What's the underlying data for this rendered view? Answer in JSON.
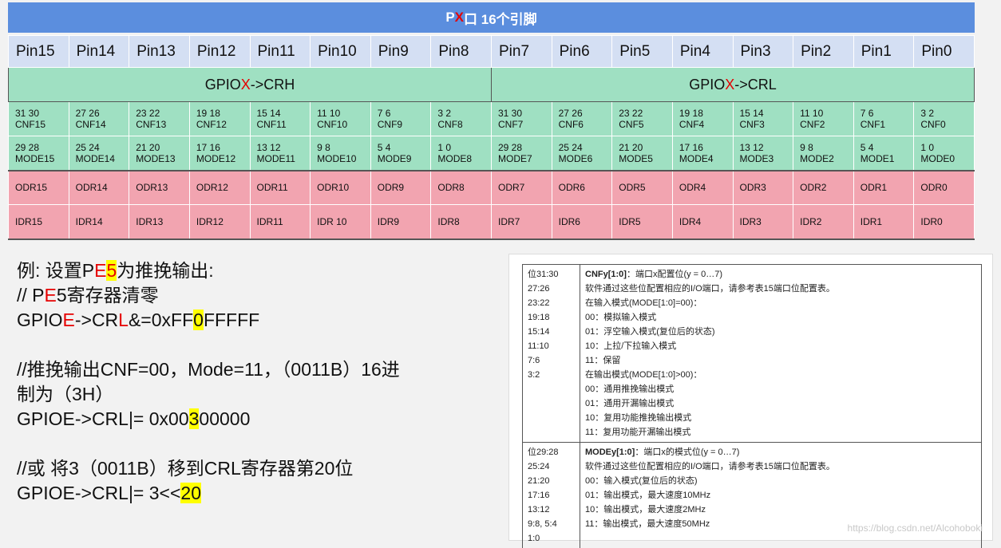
{
  "title": {
    "pre": "P",
    "red": "X",
    "post": "口 16个引脚"
  },
  "pins": [
    "Pin15",
    "Pin14",
    "Pin13",
    "Pin12",
    "Pin11",
    "Pin10",
    "Pin9",
    "Pin8",
    "Pin7",
    "Pin6",
    "Pin5",
    "Pin4",
    "Pin3",
    "Pin2",
    "Pin1",
    "Pin0"
  ],
  "crh": {
    "pre": "GPIO",
    "red": "X",
    "post": "->CRH"
  },
  "crl": {
    "pre": "GPIO",
    "red": "X",
    "post": "->CRL"
  },
  "cnf": [
    {
      "bits": "31 30",
      "name": "CNF15"
    },
    {
      "bits": "27 26",
      "name": "CNF14"
    },
    {
      "bits": "23  22",
      "name": "CNF13"
    },
    {
      "bits": "19  18",
      "name": "CNF12"
    },
    {
      "bits": "15  14",
      "name": "CNF11"
    },
    {
      "bits": "11  10",
      "name": "CNF10"
    },
    {
      "bits": "7  6",
      "name": "CNF9"
    },
    {
      "bits": "3   2",
      "name": "CNF8"
    },
    {
      "bits": "31 30",
      "name": "CNF7"
    },
    {
      "bits": "27 26",
      "name": "CNF6"
    },
    {
      "bits": "23 22",
      "name": "CNF5"
    },
    {
      "bits": "19 18",
      "name": "CNF4"
    },
    {
      "bits": "15 14",
      "name": "CNF3"
    },
    {
      "bits": "11 10",
      "name": "CNF2"
    },
    {
      "bits": "7   6",
      "name": "CNF1"
    },
    {
      "bits": "3  2",
      "name": "CNF0"
    }
  ],
  "mode": [
    {
      "bits": "29 28",
      "name": "MODE15"
    },
    {
      "bits": "25 24",
      "name": "MODE14"
    },
    {
      "bits": "21  20",
      "name": "MODE13"
    },
    {
      "bits": "17  16",
      "name": "MODE12"
    },
    {
      "bits": "13  12",
      "name": "MODE11"
    },
    {
      "bits": "9  8",
      "name": "MODE10"
    },
    {
      "bits": "5 4",
      "name": "MODE9"
    },
    {
      "bits": "1   0",
      "name": "MODE8"
    },
    {
      "bits": "29 28",
      "name": "MODE7"
    },
    {
      "bits": "25 24",
      "name": "MODE6"
    },
    {
      "bits": "21 20",
      "name": "MODE5"
    },
    {
      "bits": "17 16",
      "name": "MODE4"
    },
    {
      "bits": "13 12",
      "name": "MODE3"
    },
    {
      "bits": "9   8",
      "name": "MODE2"
    },
    {
      "bits": "5   4",
      "name": "MODE1"
    },
    {
      "bits": "1   0",
      "name": "MODE0"
    }
  ],
  "odr": [
    "ODR15",
    "ODR14",
    "ODR13",
    "ODR12",
    "ODR11",
    "ODR10",
    "ODR9",
    "ODR8",
    "ODR7",
    "ODR6",
    "ODR5",
    "ODR4",
    "ODR3",
    "ODR2",
    "ODR1",
    "ODR0"
  ],
  "idr": [
    "IDR15",
    "IDR14",
    "IDR13",
    "IDR12",
    "IDR11",
    "IDR 10",
    "IDR9",
    "IDR8",
    "IDR7",
    "IDR6",
    "IDR5",
    "IDR4",
    "IDR3",
    "IDR2",
    "IDR1",
    "IDR0"
  ],
  "example": {
    "l1": {
      "a": "例: 设置P",
      "b": "E",
      "c": "5",
      "d": "为推挽输出:"
    },
    "l2": {
      "a": "// P",
      "b": "E",
      "c": "5寄存器清零"
    },
    "l3": {
      "a": "GPIO",
      "b": "E",
      "c": "->CR",
      "d": "L",
      "e": "&=0xFF",
      "f": "0",
      "g": "FFFFF"
    },
    "l5": "//推挽输出CNF=00，Mode=11，（0011B）16进",
    "l6": "制为（3H）",
    "l7": {
      "a": "GPIOE->CRL|= 0x00",
      "b": "3",
      "c": "00000"
    },
    "l9": "//或 将3（0011B）移到CRL寄存器第20位",
    "l10": {
      "a": "GPIOE->CRL|= 3<<",
      "b": "20"
    }
  },
  "ref": {
    "cnf": {
      "bits": [
        "位31:30",
        "27:26",
        "23:22",
        "19:18",
        "15:14",
        "11:10",
        "7:6",
        "3:2"
      ],
      "fname": "CNFy[1:0]",
      "fdesc": "：端口x配置位(y = 0…7)",
      "lines": [
        "软件通过这些位配置相应的I/O端口，请参考表15端口位配置表。",
        "在输入模式(MODE[1:0]=00)：",
        "00：模拟输入模式",
        "01：浮空输入模式(复位后的状态)",
        "10：上拉/下拉输入模式",
        "11：保留",
        "在输出模式(MODE[1:0]>00)：",
        "00：通用推挽输出模式",
        "01：通用开漏输出模式",
        "10：复用功能推挽输出模式",
        "11：复用功能开漏输出模式"
      ]
    },
    "mode": {
      "bits": [
        "位29:28",
        "25:24",
        "21:20",
        "17:16",
        "13:12",
        "9:8, 5:4",
        "1:0"
      ],
      "fname": "MODEy[1:0]",
      "fdesc": "：端口x的模式位(y = 0…7)",
      "lines": [
        "软件通过这些位配置相应的I/O端口，请参考表15端口位配置表。",
        "00：输入模式(复位后的状态)",
        "01：输出模式，最大速度10MHz",
        "10：输出模式，最大速度2MHz",
        "11：输出模式，最大速度50MHz"
      ]
    }
  },
  "watermark": "https://blog.csdn.net/Alcohoboki"
}
